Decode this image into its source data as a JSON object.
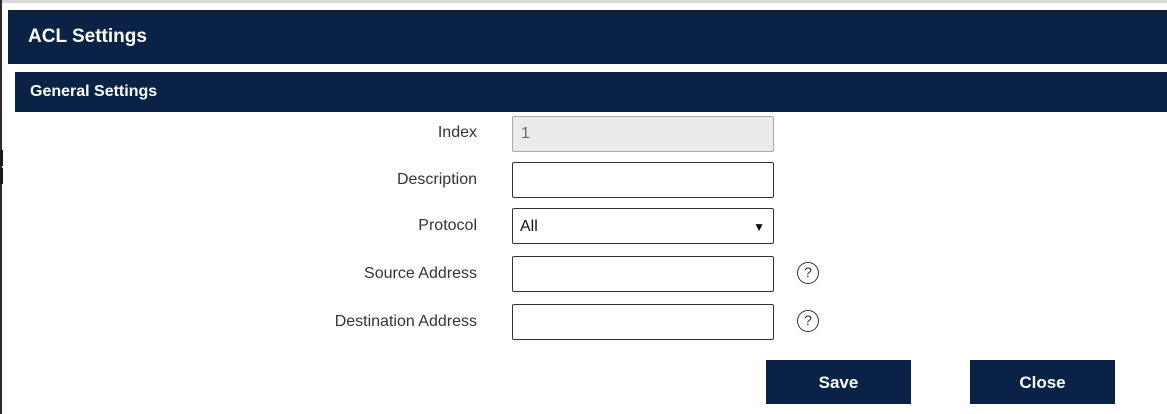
{
  "dialog": {
    "title": "ACL Settings"
  },
  "section": {
    "title": "General Settings"
  },
  "form": {
    "index": {
      "label": "Index",
      "value": "1",
      "disabled": true
    },
    "description": {
      "label": "Description",
      "value": ""
    },
    "protocol": {
      "label": "Protocol",
      "selected": "All"
    },
    "source_address": {
      "label": "Source Address",
      "value": "",
      "help_icon": "question-circle"
    },
    "destination_address": {
      "label": "Destination Address",
      "value": "",
      "help_icon": "question-circle"
    }
  },
  "buttons": {
    "save_label": "Save",
    "close_label": "Close"
  },
  "colors": {
    "header_bg": "#0a2246",
    "button_bg": "#0a2246",
    "text": "#333333"
  }
}
